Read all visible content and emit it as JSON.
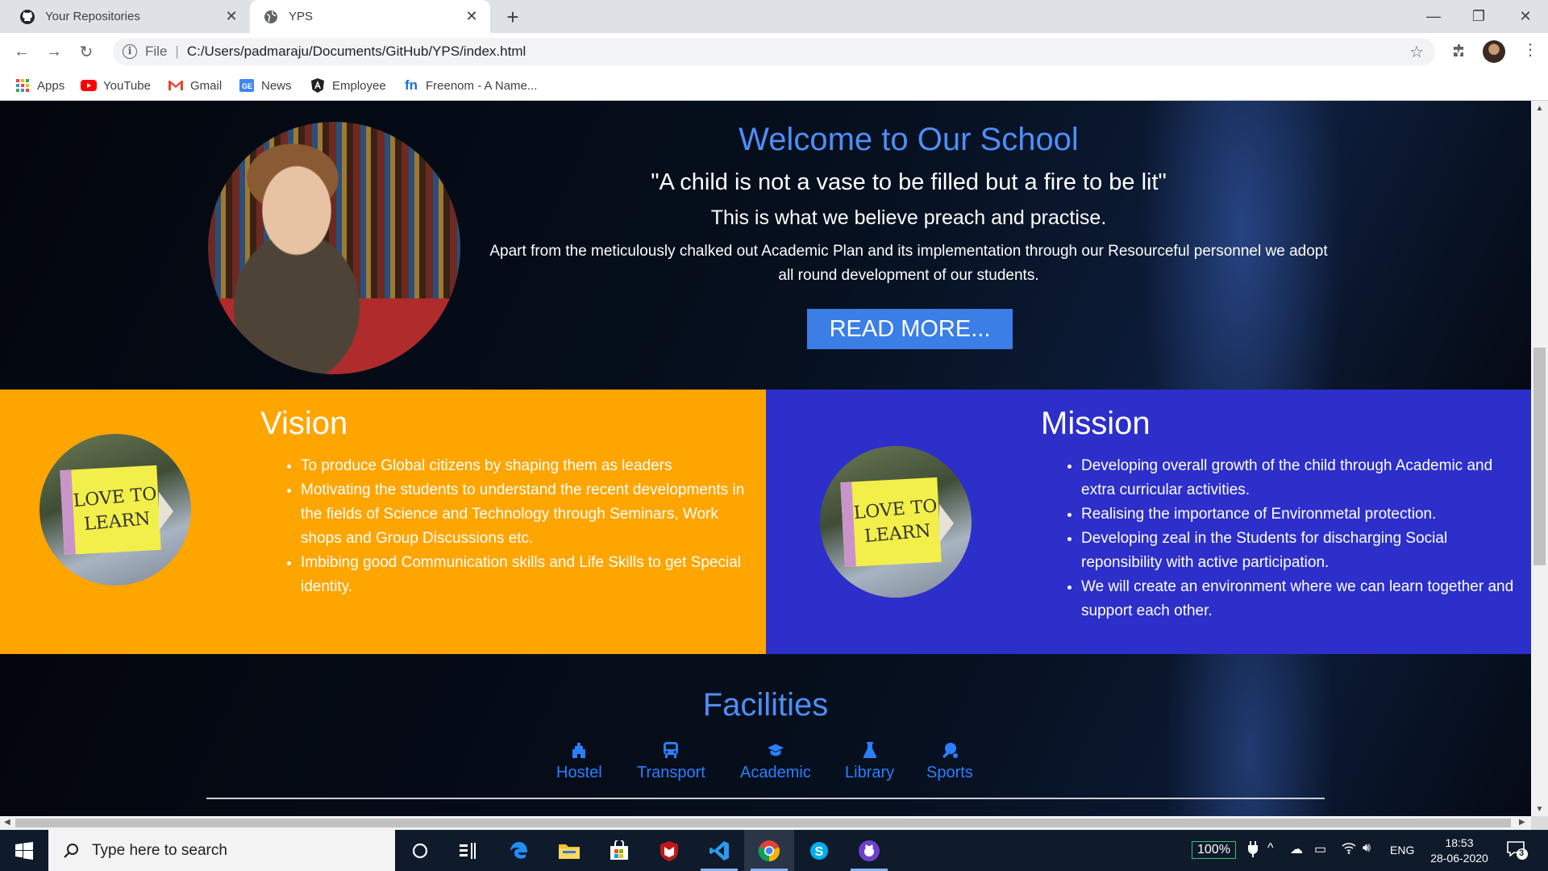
{
  "browser": {
    "tabs": [
      {
        "title": "Your Repositories",
        "icon": "github-icon",
        "active": false
      },
      {
        "title": "YPS",
        "icon": "globe-icon",
        "active": true
      }
    ],
    "address": {
      "scheme": "File",
      "url": "C:/Users/padmaraju/Documents/GitHub/YPS/index.html"
    },
    "bookmarks": [
      {
        "label": "Apps",
        "icon": "apps-grid-icon"
      },
      {
        "label": "YouTube",
        "icon": "youtube-icon"
      },
      {
        "label": "Gmail",
        "icon": "gmail-icon"
      },
      {
        "label": "News",
        "icon": "google-news-icon"
      },
      {
        "label": "Employee",
        "icon": "angular-icon"
      },
      {
        "label": "Freenom - A Name...",
        "icon": "freenom-icon"
      }
    ]
  },
  "hero": {
    "title": "Welcome to Our School",
    "quote": "\"A child is not a vase to be filled but a fire to be lit\"",
    "belief": "This is what we believe preach and practise.",
    "description": "Apart from the meticulously chalked out Academic Plan and its implementation through our Resourceful personnel we adopt all round development of our students.",
    "button": "READ MORE..."
  },
  "vision": {
    "title": "Vision",
    "image_text": "LOVE TO LEARN",
    "items": [
      "To produce Global citizens by shaping them as leaders",
      "Motivating the students to understand the recent developments in the fields of Science and Technology through Seminars, Work shops and Group Discussions etc.",
      "Imbibing good Communication skills and Life Skills to get Special identity."
    ]
  },
  "mission": {
    "title": "Mission",
    "image_text": "LOVE TO LEARN",
    "items": [
      "Developing overall growth of the child through Academic and extra curricular activities.",
      "Realising the importance of Environmetal protection.",
      "Developing zeal in the Students for discharging Social reponsibility with active participation.",
      "We will create an environment where we can learn together and support each other."
    ]
  },
  "facilities": {
    "title": "Facilities",
    "items": [
      {
        "label": "Hostel",
        "icon": "hostel-icon"
      },
      {
        "label": "Transport",
        "icon": "bus-icon"
      },
      {
        "label": "Academic",
        "icon": "graduation-cap-icon"
      },
      {
        "label": "Library",
        "icon": "flask-icon"
      },
      {
        "label": "Sports",
        "icon": "sports-icon"
      }
    ]
  },
  "taskbar": {
    "search_placeholder": "Type here to search",
    "battery": "100%",
    "language": "ENG",
    "time": "18:53",
    "date": "28-06-2020",
    "notifications": "3"
  },
  "colors": {
    "accent_blue": "#4e8ef7",
    "vision_bg": "#ffa500",
    "mission_bg": "#2c2fc9",
    "button_bg": "#3a7ee6",
    "facility_icon": "#2a7fff"
  }
}
